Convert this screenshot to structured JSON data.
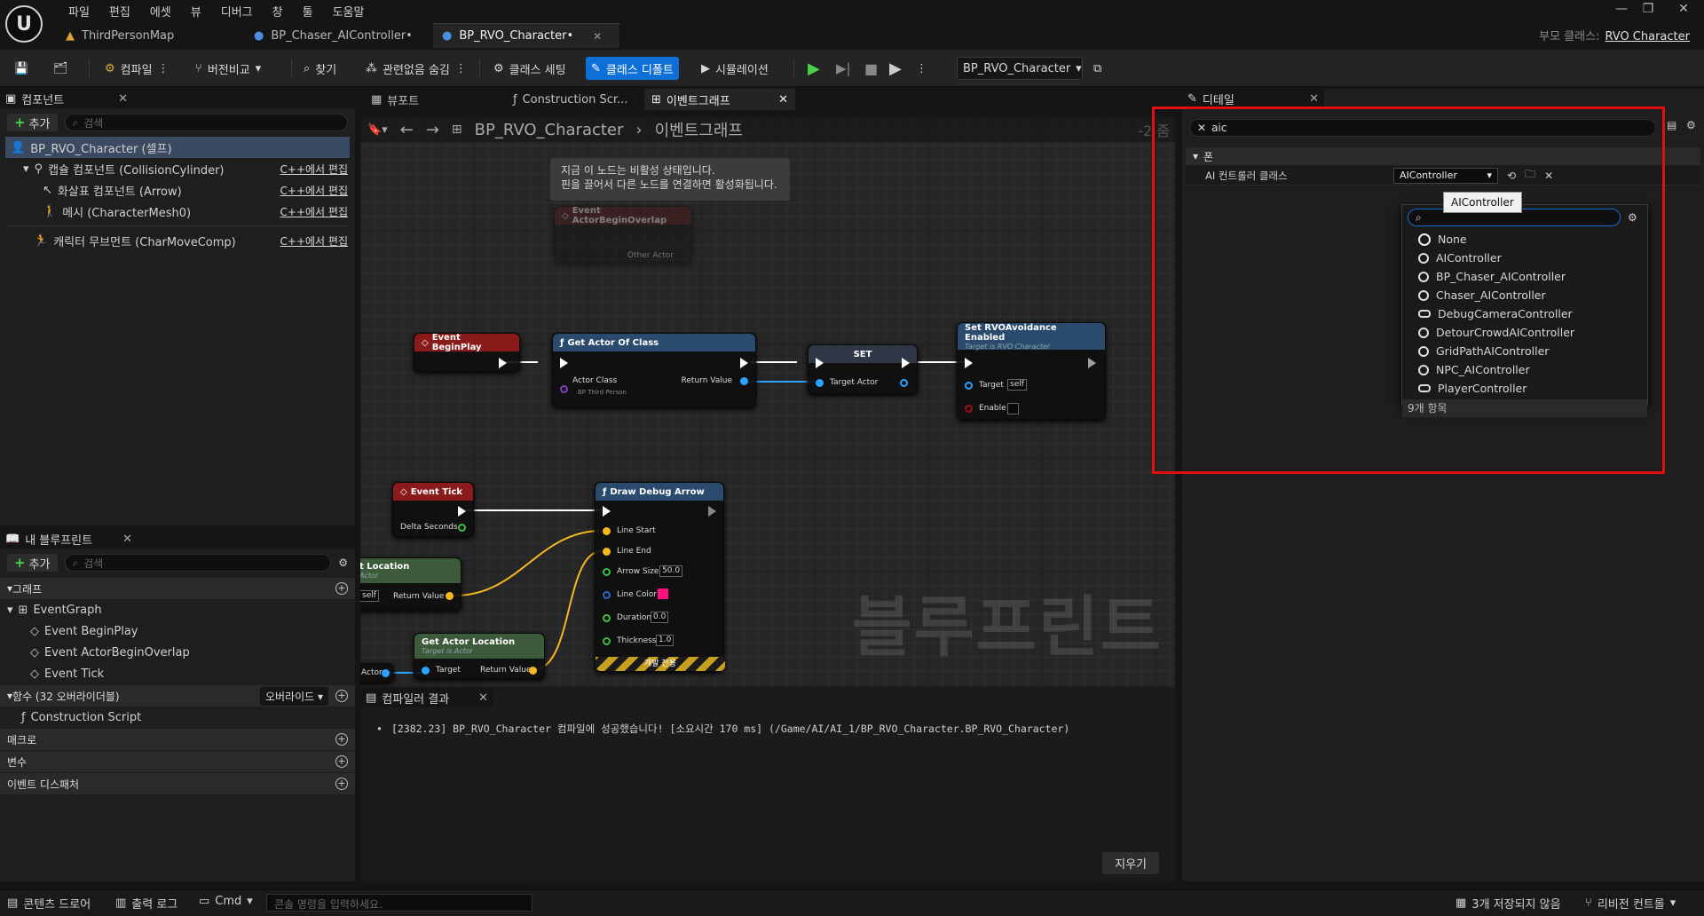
{
  "menu": [
    "파일",
    "편집",
    "에셋",
    "뷰",
    "디버그",
    "창",
    "툴",
    "도움말"
  ],
  "tabs": [
    {
      "label": "ThirdPersonMap"
    },
    {
      "label": "BP_Chaser_AIController•"
    },
    {
      "label": "BP_RVO_Character•"
    }
  ],
  "parent_class": {
    "label": "부모 클래스:",
    "value": "RVO Character"
  },
  "toolbar": {
    "compile": "컴파일",
    "diff": "버전비교",
    "find": "찾기",
    "hide_unrelated": "관련없음 숨김",
    "class_settings": "클래스 세팅",
    "class_defaults": "클래스 디폴트",
    "simulation": "시뮬레이션",
    "debug_object": "BP_RVO_Character"
  },
  "components": {
    "title": "컴포넌트",
    "add": "추가",
    "search_placeholder": "검색",
    "root": "BP_RVO_Character (셀프)",
    "items": [
      {
        "label": "캡슐 컴포넌트 (CollisionCylinder)",
        "link": "C++에서 편집"
      },
      {
        "label": "화살표 컴포넌트 (Arrow)",
        "link": "C++에서 편집"
      },
      {
        "label": "메시 (CharacterMesh0)",
        "link": "C++에서 편집"
      },
      {
        "label": "캐릭터 무브먼트 (CharMoveComp)",
        "link": "C++에서 편집"
      }
    ]
  },
  "my_blueprint": {
    "title": "내 블루프린트",
    "add": "추가",
    "search_placeholder": "검색",
    "graph_section": "그래프",
    "event_graph": "EventGraph",
    "events": [
      "Event BeginPlay",
      "Event ActorBeginOverlap",
      "Event Tick"
    ],
    "functions_section": "함수 (32 오버라이더블)",
    "override": "오버라이드",
    "construction": "Construction Script",
    "macros": "매크로",
    "variables": "변수",
    "dispatchers": "이벤트 디스패처"
  },
  "graph_tabs": {
    "viewport": "뷰포트",
    "construction": "Construction Scr...",
    "event_graph": "이벤트그래프"
  },
  "breadcrumb": {
    "root": "BP_RVO_Character",
    "current": "이벤트그래프",
    "zoom": "-2 줌"
  },
  "comment": {
    "line1": "지금 이 노드는 비활성 상태입니다.",
    "line2": "핀을 끌어서 다른 노드를 연결하면 활성화됩니다."
  },
  "nodes": {
    "overlap": {
      "title": "Event ActorBeginOverlap",
      "pin": "Other Actor"
    },
    "beginplay": {
      "title": "Event BeginPlay"
    },
    "getactor": {
      "title": "Get Actor Of Class",
      "actor_class": "Actor Class",
      "class_value": "BP Third Person",
      "return": "Return Value"
    },
    "set": {
      "title": "SET",
      "pin": "Target Actor"
    },
    "setrvo": {
      "title": "Set RVOAvoidance Enabled",
      "sub": "Target is RVO Character",
      "target": "Target",
      "target_val": "self",
      "enable": "Enable"
    },
    "tick": {
      "title": "Event Tick",
      "delta": "Delta Seconds"
    },
    "drawarrow": {
      "title": "Draw Debug Arrow",
      "start": "Line Start",
      "end": "Line End",
      "arrowsize": "Arrow Size",
      "arrowsize_val": "50.0",
      "color": "Line Color",
      "duration": "Duration",
      "duration_val": "0.0",
      "thickness": "Thickness",
      "thickness_val": "1.0",
      "devonly": "개발 전용"
    },
    "getloc1": {
      "title": "t Location",
      "sub": "Actor",
      "target_val": "self",
      "return": "Return Value"
    },
    "getloc2": {
      "title": "Get Actor Location",
      "sub": "Target is Actor",
      "target": "Target",
      "return": "Return Value"
    },
    "actorvar": "Actor"
  },
  "watermark": "블루프린트",
  "compiler": {
    "title": "컴파일러 결과",
    "message": "[2382.23] BP_RVO_Character 컴파일에 성공했습니다! [소요시간 170 ms] (/Game/AI/AI_1/BP_RVO_Character.BP_RVO_Character)",
    "clear": "지우기"
  },
  "details": {
    "title": "디테일",
    "search_value": "aic",
    "category": "폰",
    "prop_label": "AI 컨트롤러 클래스",
    "prop_value": "AIController",
    "tooltip": "AIController",
    "options": [
      {
        "label": "None",
        "icon": "none"
      },
      {
        "label": "AIController",
        "icon": "pawn"
      },
      {
        "label": "BP_Chaser_AIController",
        "icon": "pawn"
      },
      {
        "label": "Chaser_AIController",
        "icon": "pawn"
      },
      {
        "label": "DebugCameraController",
        "icon": "pad"
      },
      {
        "label": "DetourCrowdAIController",
        "icon": "pawn"
      },
      {
        "label": "GridPathAIController",
        "icon": "pawn"
      },
      {
        "label": "NPC_AIController",
        "icon": "pawn"
      },
      {
        "label": "PlayerController",
        "icon": "pad"
      }
    ],
    "count": "9개 항목"
  },
  "statusbar": {
    "content_drawer": "콘텐츠 드로어",
    "output_log": "출력 로그",
    "cmd": "Cmd",
    "cmd_placeholder": "콘솔 명령을 입력하세요.",
    "unsaved": "3개 저장되지 않음",
    "revision": "리비전 컨트롤"
  },
  "colors": {
    "accent": "#0e6fd6",
    "highlight_box": "#e01010",
    "event_node": "#8b1a1a",
    "function_node": "#2a4a6e",
    "pure_node": "#3d5a3a"
  }
}
